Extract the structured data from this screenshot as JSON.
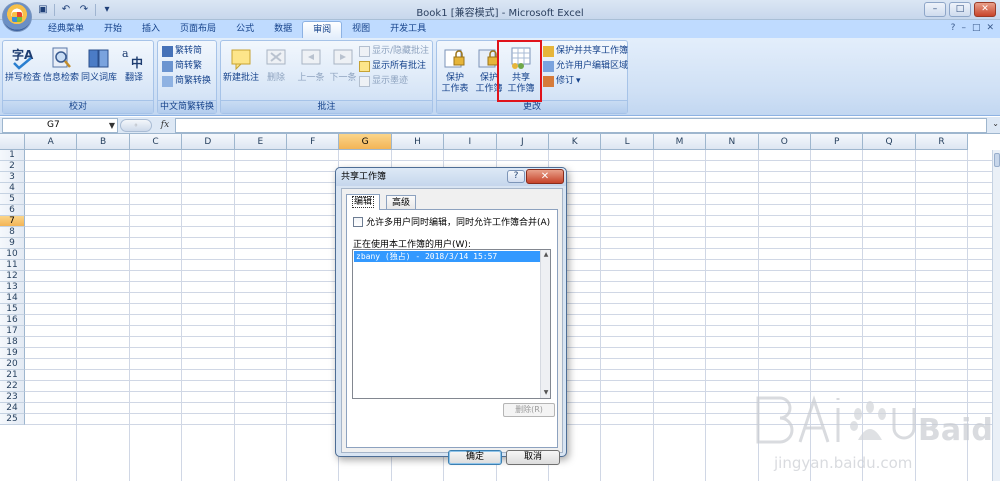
{
  "window": {
    "title": "Book1  [兼容模式] - Microsoft Excel",
    "controls": [
      "–",
      "□",
      "✕"
    ],
    "doc_controls": [
      "–",
      "□",
      "✕"
    ]
  },
  "tabs": [
    "经典菜单",
    "开始",
    "插入",
    "页面布局",
    "公式",
    "数据",
    "审阅",
    "视图",
    "开发工具"
  ],
  "active_tab": "审阅",
  "help_icon": "?",
  "ribbon": {
    "proofing": {
      "label": "校对",
      "buttons": [
        "拼写检查",
        "信息检索",
        "同义词库",
        "翻译"
      ]
    },
    "chinese": {
      "label": "中文简繁转换",
      "buttons": [
        "繁转简",
        "简转繁",
        "简繁转换"
      ]
    },
    "comments": {
      "label": "批注",
      "buttons": [
        "新建批注",
        "删除",
        "上一条",
        "下一条"
      ],
      "small": [
        "显示/隐藏批注",
        "显示所有批注",
        "显示墨迹"
      ]
    },
    "changes": {
      "label": "更改",
      "protect_sheet": [
        "保护",
        "工作表"
      ],
      "protect_workbook": [
        "保护",
        "工作簿"
      ],
      "share_workbook": [
        "共享",
        "工作簿"
      ],
      "small": [
        "保护并共享工作簿",
        "允许用户编辑区域",
        "修订"
      ]
    }
  },
  "formula_bar": {
    "name_box": "G7",
    "fx": "fx",
    "value": ""
  },
  "grid": {
    "columns": [
      "A",
      "B",
      "C",
      "D",
      "E",
      "F",
      "G",
      "H",
      "I",
      "J",
      "K",
      "L",
      "M",
      "N",
      "O",
      "P",
      "Q",
      "R"
    ],
    "rows": [
      "1",
      "2",
      "3",
      "4",
      "5",
      "6",
      "7",
      "8",
      "9",
      "10",
      "11",
      "12",
      "13",
      "14",
      "15",
      "16",
      "17",
      "18",
      "19",
      "20",
      "21",
      "22",
      "23",
      "24",
      "25"
    ],
    "selected_column": "G",
    "selected_row": "7"
  },
  "dialog": {
    "title": "共享工作簿",
    "help": "?",
    "close": "✕",
    "tabs": [
      "编辑",
      "高级"
    ],
    "checkbox_label": "允许多用户同时编辑，同时允许工作簿合并(A)",
    "checkbox_checked": false,
    "users_label": "正在使用本工作簿的用户(W):",
    "users": [
      "zbany (独占) - 2018/3/14 15:57"
    ],
    "remove_label": "删除(R)",
    "ok_label": "确定",
    "cancel_label": "取消"
  },
  "watermark": {
    "brand": "Baidu经验",
    "url": "jingyan.baidu.com"
  },
  "colors": {
    "highlight": "#e0131b",
    "selection": "#3399ff",
    "ribbon_bg": "#cfe0f5",
    "header_sel": "#f3b456"
  }
}
